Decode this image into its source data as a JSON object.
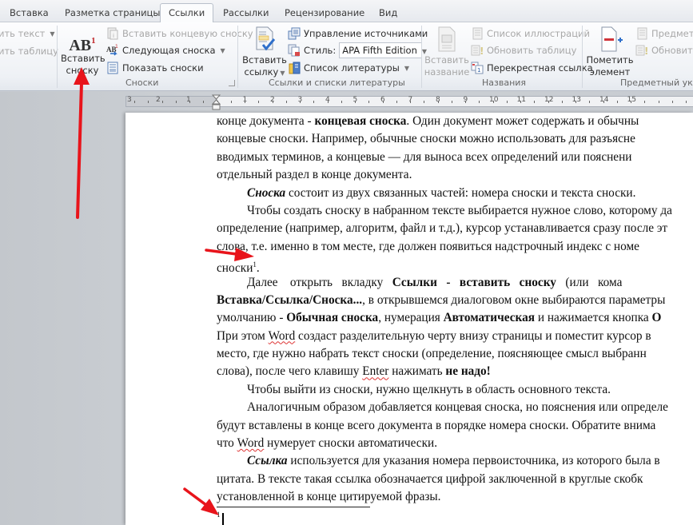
{
  "tabs": [
    {
      "label": "Вставка",
      "active": false
    },
    {
      "label": "Разметка страницы",
      "active": false
    },
    {
      "label": "Ссылки",
      "active": true
    },
    {
      "label": "Рассылки",
      "active": false
    },
    {
      "label": "Рецензирование",
      "active": false
    },
    {
      "label": "Вид",
      "active": false
    }
  ],
  "ribbon": {
    "toc_group": {
      "add_text": "ить текст",
      "update_table": "ить таблицу"
    },
    "footnotes": {
      "insert_footnote": "Вставить сноску",
      "insert_footnote_l1": "Вставить",
      "insert_footnote_l2": "сноску",
      "insert_endnote": "Вставить концевую сноску",
      "next_footnote": "Следующая сноска",
      "show_notes": "Показать сноски",
      "label": "Сноски"
    },
    "citations": {
      "insert_citation_l1": "Вставить",
      "insert_citation_l2": "ссылку",
      "manage_sources": "Управление источниками",
      "style_label": "Стиль:",
      "style_value": "APA Fifth Edition",
      "bibliography": "Список литературы",
      "label": "Ссылки и списки литературы"
    },
    "captions": {
      "insert_caption_l1": "Вставить",
      "insert_caption_l2": "название",
      "table_of_figures": "Список иллюстраций",
      "update_table": "Обновить таблицу",
      "cross_reference": "Перекрестная ссылка",
      "label": "Названия"
    },
    "index": {
      "mark_entry_l1": "Пометить",
      "mark_entry_l2": "элемент",
      "insert_index": "Предметн",
      "update_index": "Обновить",
      "label": "Предметный указ"
    }
  },
  "ruler": {
    "left_numbers": [
      "3",
      "2",
      "1"
    ],
    "right_numbers": [
      "1",
      "2",
      "3",
      "4",
      "5",
      "6",
      "7",
      "8",
      "9",
      "10",
      "11",
      "12",
      "13",
      "14",
      "15"
    ]
  },
  "document": {
    "lines": {
      "l1a": "конце документа - ",
      "l1b": "концевая сноска",
      "l1c": ". Один документ может содержать и обычны",
      "l2": "концевые сноски. Например, обычные сноски можно использовать для разъясне",
      "l3": "вводимых терминов, а концевые — для выноса всех определений или пояснени",
      "l4": "отдельный раздел в конце документа.",
      "l5a": "Сноска",
      "l5b": " состоит из двух связанных частей: номера сноски и текста сноски.",
      "l6": "Чтобы создать сноску в набранном тексте выбирается нужное слово, которому да",
      "l7": "определение (например, алгоритм, файл и т.д.), курсор устанавливается сразу после эт",
      "l8": "слова, т.е. именно в том месте, где должен появиться надстрочный индекс с номе",
      "l9a": "сноски",
      "l9sup": "1",
      "l9b": ".",
      "l10a": "Далее    открыть   вкладку   ",
      "l10b": "Ссылки   -   вставить   сноску",
      "l10c": "   (или   кома",
      "l11a": "Вставка/Ссылка/Сноска...",
      "l11b": ", в открывшемся диалоговом окне выбираются параметры",
      "l12a": "умолчанию - ",
      "l12b": "Обычная сноска",
      "l12c": ", нумерация ",
      "l12d": "Автоматическая",
      "l12e": " и нажимается кнопка ",
      "l12f": "О",
      "l13a": "При этом ",
      "l13word": "Word",
      "l13b": " создаст разделительную черту внизу страницы и поместит курсор в",
      "l14": "место, где нужно набрать текст сноски (определение, поясняющее смысл выбранн",
      "l15a": "слова), после чего клавишу ",
      "l15enter": "Enter",
      "l15b": " нажимать ",
      "l15c": "не надо!",
      "l16": "Чтобы выйти из сноски, нужно щелкнуть в область основного текста.",
      "l17": "Аналогичным образом добавляется концевая сноска, но пояснения или определе",
      "l18": "будут вставлены в конце всего документа в порядке номера сноски. Обратите внима",
      "l19a": "что ",
      "l19word": "Word",
      "l19b": " нумерует сноски автоматически.",
      "l20a": "Ссылка",
      "l20b": " используется для указания номера первоисточника, из которого была в",
      "l21": "цитата. В тексте такая ссылка обозначается цифрой заключенной в круглые скобк",
      "l22": "установленной в конце цитируемой фразы."
    },
    "footnote_number": "1"
  },
  "colors": {
    "annotation_arrow": "#e8141b"
  }
}
